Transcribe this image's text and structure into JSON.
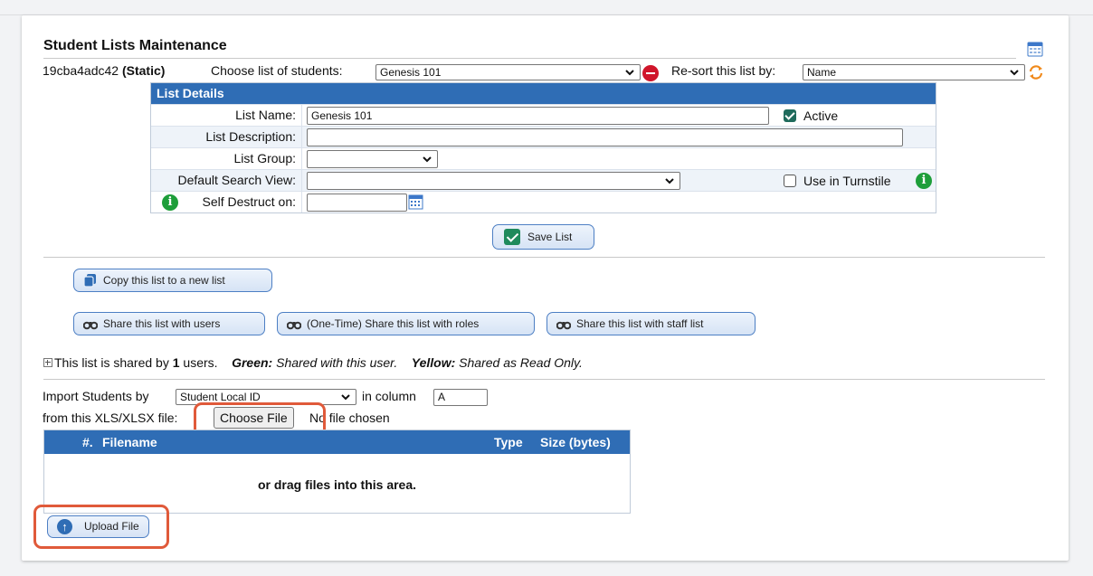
{
  "page": {
    "title": "Student Lists Maintenance",
    "list_id": "19cba4adc42",
    "list_type": "(Static)",
    "choose_label": "Choose list of students:",
    "choose_value": "Genesis 101",
    "resort_label": "Re-sort this list by:",
    "resort_value": "Name"
  },
  "details": {
    "header": "List Details",
    "name_label": "List Name:",
    "name_value": "Genesis 101",
    "active_label": "Active",
    "desc_label": "List Description:",
    "desc_value": "",
    "group_label": "List Group:",
    "group_value": "",
    "view_label": "Default Search View:",
    "view_value": "",
    "turnstile_label": "Use in Turnstile",
    "destruct_label": "Self Destruct on:",
    "destruct_value": "",
    "save_label": "Save List"
  },
  "actions": {
    "copy_label": "Copy this list to a new list",
    "share_users_label": "Share this list with users",
    "share_roles_label": "(One-Time) Share this list with roles",
    "share_staff_label": "Share this list with staff list"
  },
  "shared": {
    "prefix": "This list is shared by",
    "count": "1",
    "suffix": "users.",
    "green_label": "Green:",
    "green_text": "Shared with this user.",
    "yellow_label": "Yellow:",
    "yellow_text": "Shared as Read Only."
  },
  "import": {
    "by_label": "Import Students by",
    "by_value": "Student Local ID",
    "column_label": "in column",
    "column_value": "A",
    "file_label": "from this XLS/XLSX file:",
    "choose_file_label": "Choose File",
    "no_file_text": "No file chosen",
    "col_num": "#.",
    "col_filename": "Filename",
    "col_type": "Type",
    "col_size": "Size (bytes)",
    "drop_text": "or drag files into this area.",
    "upload_label": "Upload File"
  },
  "colors": {
    "header_blue": "#2f6db5",
    "highlight": "#e05a3a",
    "info_green": "#1e9e3a",
    "stop_red": "#d0152a"
  }
}
